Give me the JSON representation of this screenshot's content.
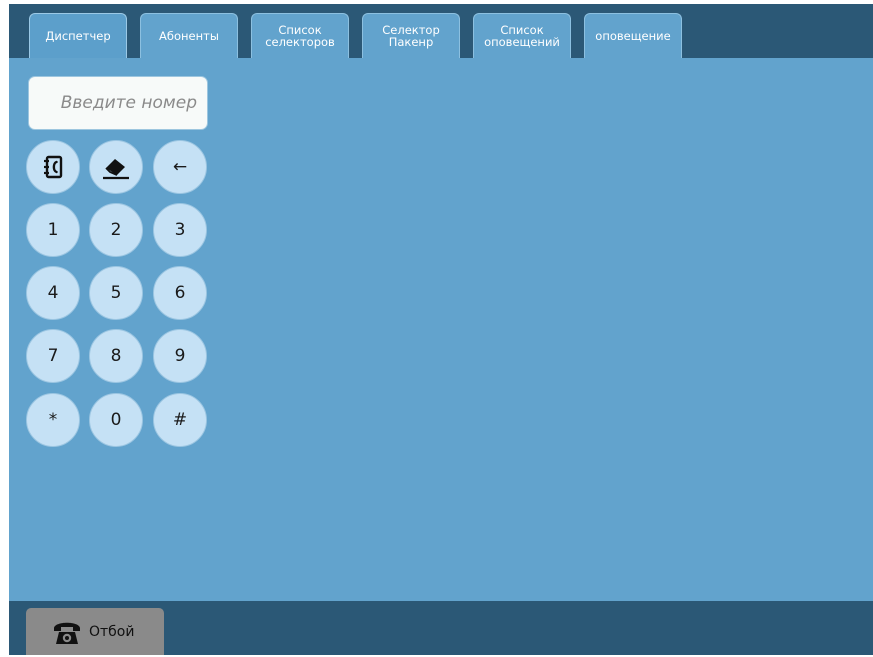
{
  "tabs": [
    {
      "label": "Диспетчер",
      "active": true
    },
    {
      "label": "Абоненты",
      "active": false
    },
    {
      "label": "Список\nселекторов",
      "active": false
    },
    {
      "label": "Селектор\nПакенр",
      "active": false
    },
    {
      "label": "Список\nоповещений",
      "active": false
    },
    {
      "label": "оповещение",
      "active": false
    }
  ],
  "dialer": {
    "placeholder": "Введите номер",
    "value": "",
    "back_key": "←",
    "keys": [
      "1",
      "2",
      "3",
      "4",
      "5",
      "6",
      "7",
      "8",
      "9",
      "*",
      "0",
      "#"
    ]
  },
  "footer": {
    "hangup_label": "Отбой"
  },
  "colors": {
    "background": "#62a3cd",
    "bars": "#2b5876",
    "key_fill": "#c5e1f5",
    "hangup_button": "#8a8a8a"
  },
  "icons": {
    "phonebook": "phonebook-icon",
    "clear": "eraser-icon",
    "hangup": "telephone-icon"
  }
}
